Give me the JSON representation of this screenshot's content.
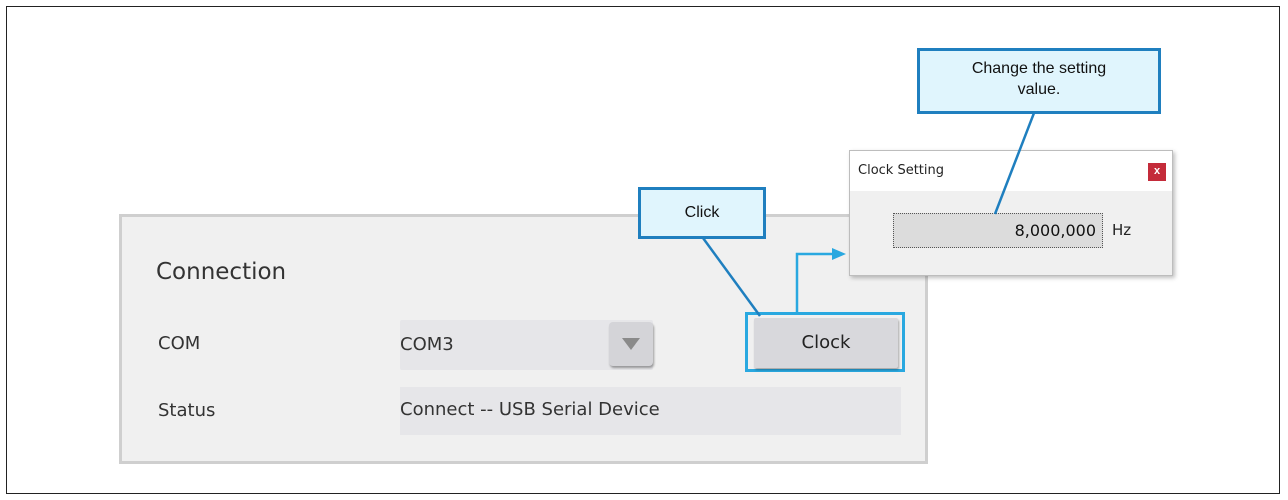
{
  "connection": {
    "title": "Connection",
    "com_label": "COM",
    "com_value": "COM3",
    "status_label": "Status",
    "status_value": "Connect -- USB Serial Device",
    "clock_button": "Clock"
  },
  "dialog": {
    "title": "Clock Setting",
    "close": "x",
    "value": "8,000,000",
    "unit": "Hz"
  },
  "callouts": {
    "click": "Click",
    "change_line1": "Change the setting",
    "change_line2": "value."
  },
  "colors": {
    "highlight": "#29a8e0",
    "callout_border": "#1f7fbf",
    "callout_fill": "#e0f5fd",
    "close_button": "#c42b3a"
  },
  "icons": {
    "dropdown": "triangle-down-icon",
    "close": "close-icon",
    "connector": "arrow-right-icon"
  }
}
